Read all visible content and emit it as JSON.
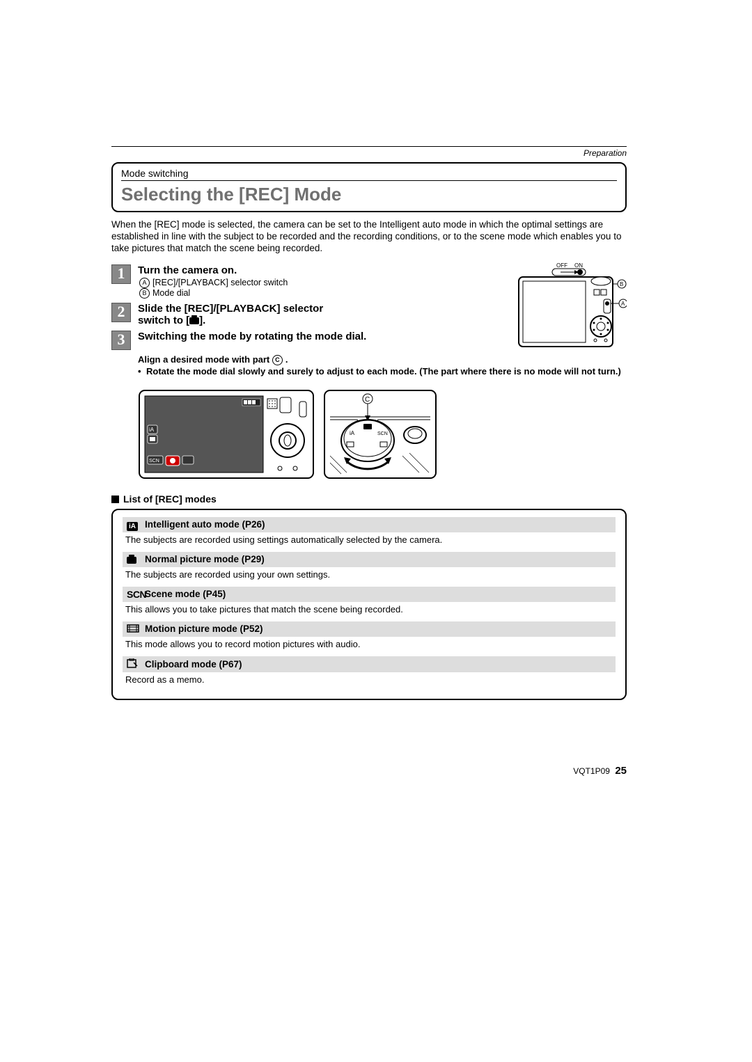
{
  "header": {
    "section": "Preparation",
    "category": "Mode switching",
    "title": "Selecting the [REC] Mode"
  },
  "intro": "When the [REC] mode is selected, the camera can be set to the Intelligent auto mode in which the optimal settings are established in line with the subject to be recorded and the recording conditions, or to the scene mode which enables you to take pictures that match the scene being recorded.",
  "steps": [
    {
      "num": "1",
      "title": "Turn the camera on.",
      "sub": [
        {
          "mark": "A",
          "text": "[REC]/[PLAYBACK] selector switch"
        },
        {
          "mark": "B",
          "text": "Mode dial"
        }
      ]
    },
    {
      "num": "2",
      "title_a": "Slide the [REC]/[PLAYBACK] selector",
      "title_b": "switch to [",
      "title_c": "]."
    },
    {
      "num": "3",
      "title": "Switching the mode by rotating the mode dial."
    }
  ],
  "step3_notes": {
    "line1_a": "Align a desired mode with part ",
    "line1_mark": "C",
    "line1_b": ".",
    "bullet": "Rotate the mode dial slowly and surely to adjust to each mode. (The part where there is no mode will not turn.)"
  },
  "diagram": {
    "off": "OFF",
    "on": "ON",
    "markA": "A",
    "markB": "B",
    "markC": "C",
    "scn": "SCN"
  },
  "list_header": "List of [REC] modes",
  "modes": [
    {
      "icon": "iA",
      "title": "Intelligent auto mode (P26)",
      "desc": "The subjects are recorded using settings automatically selected by the camera."
    },
    {
      "icon": "camera",
      "title": "Normal picture mode (P29)",
      "desc": "The subjects are recorded using your own settings."
    },
    {
      "icon": "SCN",
      "title": "Scene mode (P45)",
      "desc": "This allows you to take pictures that match the scene being recorded."
    },
    {
      "icon": "motion",
      "title": "Motion picture mode (P52)",
      "desc": "This mode allows you to record motion pictures with audio."
    },
    {
      "icon": "clipboard",
      "title": "Clipboard mode (P67)",
      "desc": "Record as a memo."
    }
  ],
  "footer": {
    "code": "VQT1P09",
    "page": "25"
  }
}
